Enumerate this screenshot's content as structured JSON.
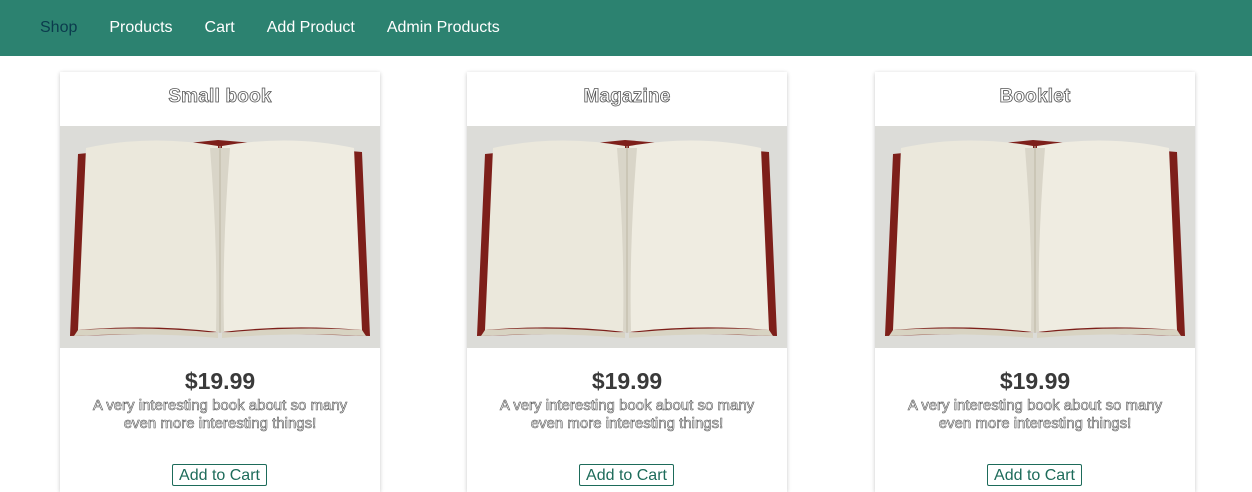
{
  "nav": {
    "items": [
      {
        "label": "Shop",
        "active": true
      },
      {
        "label": "Products",
        "active": false
      },
      {
        "label": "Cart",
        "active": false
      },
      {
        "label": "Add Product",
        "active": false
      },
      {
        "label": "Admin Products",
        "active": false
      }
    ]
  },
  "products": [
    {
      "title": "Small book",
      "image_icon": "open-book-image",
      "price": "$19.99",
      "description": "A very interesting book about so many even more interesting things!",
      "button_label": "Add to Cart"
    },
    {
      "title": "Magazine",
      "image_icon": "open-book-image",
      "price": "$19.99",
      "description": "A very interesting book about so many even more interesting things!",
      "button_label": "Add to Cart"
    },
    {
      "title": "Booklet",
      "image_icon": "open-book-image",
      "price": "$19.99",
      "description": "A very interesting book about so many even more interesting things!",
      "button_label": "Add to Cart"
    }
  ],
  "colors": {
    "header_bg": "#2c8270",
    "nav_active": "#0b3b4d",
    "button_border": "#1d6b5a",
    "price_text": "#3a3a3a"
  }
}
